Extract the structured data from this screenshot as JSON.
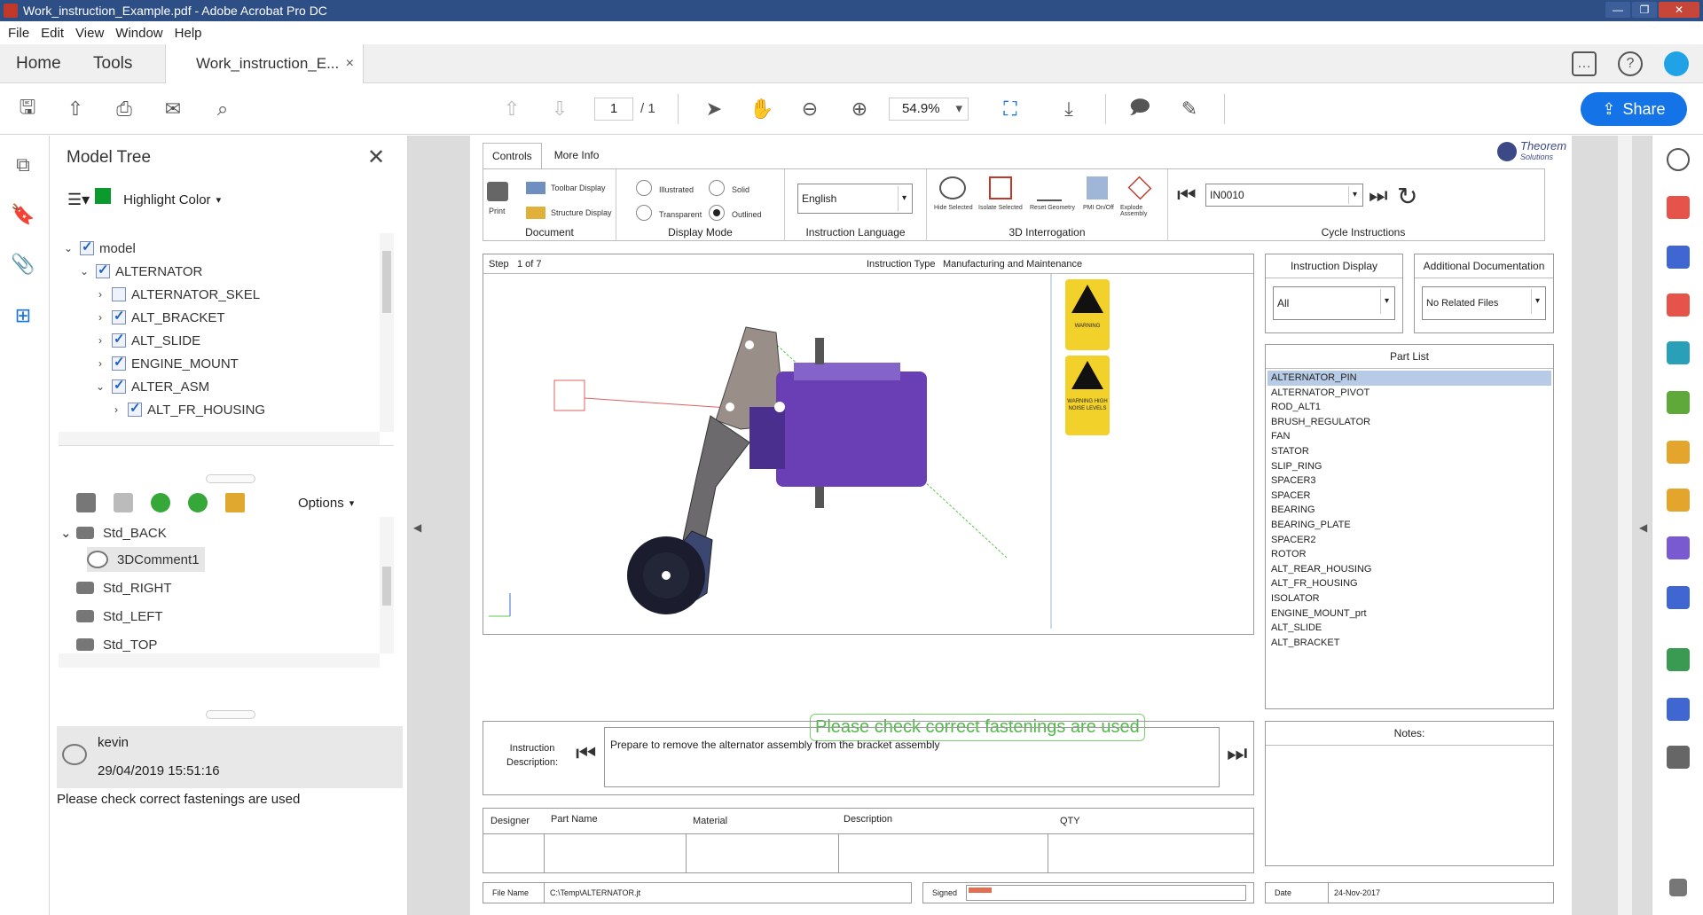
{
  "window": {
    "title": "Work_instruction_Example.pdf - Adobe Acrobat Pro DC"
  },
  "menu": [
    "File",
    "Edit",
    "View",
    "Window",
    "Help"
  ],
  "tabs": {
    "home": "Home",
    "tools": "Tools",
    "document": "Work_instruction_E...",
    "close": "×"
  },
  "toolbar": {
    "page_current": "1",
    "page_total": "/ 1",
    "zoom": "54.9%",
    "share": "Share"
  },
  "model_tree": {
    "title": "Model Tree",
    "highlight_label": "Highlight Color",
    "highlight_color": "#0b9a2d",
    "nodes": [
      {
        "label": "model",
        "checked": true
      },
      {
        "label": "ALTERNATOR",
        "checked": true
      },
      {
        "label": "ALTERNATOR_SKEL",
        "checked": false
      },
      {
        "label": "ALT_BRACKET",
        "checked": true
      },
      {
        "label": "ALT_SLIDE",
        "checked": true
      },
      {
        "label": "ENGINE_MOUNT",
        "checked": true
      },
      {
        "label": "ALTER_ASM",
        "checked": true
      },
      {
        "label": "ALT_FR_HOUSING",
        "checked": true
      }
    ],
    "options_label": "Options",
    "views": [
      "Std_BACK",
      "3DComment1",
      "Std_RIGHT",
      "Std_LEFT",
      "Std_TOP"
    ]
  },
  "comment": {
    "author": "kevin",
    "timestamp": "29/04/2019 15:51:16",
    "text": "Please check correct fastenings are used"
  },
  "doc": {
    "tabs": [
      "Controls",
      "More Info"
    ],
    "logo": {
      "name": "Theorem",
      "sub": "Solutions"
    },
    "ribbon": {
      "print": "Print",
      "toolbar_display": "Toolbar Display",
      "structure_display": "Structure Display",
      "document_label": "Document",
      "illustrated": "Illustrated",
      "solid": "Solid",
      "transparent": "Transparent",
      "outlined": "Outlined",
      "display_mode_label": "Display Mode",
      "language_value": "English",
      "language_label": "Instruction Language",
      "hide_selected": "Hide Selected",
      "isolate_selected": "Isolate Selected",
      "reset_geometry": "Reset Geometry",
      "pmi": "PMI On/Off",
      "explode": "Explode Assembly",
      "interrogation_label": "3D Interrogation",
      "cycle_value": "IN0010",
      "cycle_label": "Cycle Instructions"
    },
    "step": {
      "label": "Step",
      "value": "1 of 7",
      "type_label": "Instruction Type",
      "type_value": "Manufacturing and Maintenance"
    },
    "callout": "Please check correct fastenings are used",
    "warnings": [
      "WARNING",
      "WARNING HIGH NOISE LEVELS"
    ],
    "instruction_display": {
      "title": "Instruction Display",
      "value": "All"
    },
    "additional_docs": {
      "title": "Additional Documentation",
      "value": "No Related Files"
    },
    "part_list": {
      "title": "Part List",
      "items": [
        "ALTERNATOR_PIN",
        "ALTERNATOR_PIVOT",
        "ROD_ALT1",
        "BRUSH_REGULATOR",
        "FAN",
        "STATOR",
        "SLIP_RING",
        "SPACER3",
        "SPACER",
        "BEARING",
        "BEARING_PLATE",
        "SPACER2",
        "ROTOR",
        "ALT_REAR_HOUSING",
        "ALT_FR_HOUSING",
        "ISOLATOR",
        "ENGINE_MOUNT_prt",
        "ALT_SLIDE",
        "ALT_BRACKET"
      ]
    },
    "instruction": {
      "label_line1": "Instruction",
      "label_line2": "Description:",
      "text": "Prepare to remove the alternator assembly from the bracket assembly"
    },
    "notes_title": "Notes:",
    "table_headers": [
      "Designer",
      "Part Name",
      "Material",
      "Description",
      "QTY"
    ],
    "footer": {
      "file_name_label": "File Name",
      "file_name": "C:\\Temp\\ALTERNATOR.jt",
      "signed_label": "Signed",
      "date_label": "Date",
      "date": "24-Nov-2017"
    }
  }
}
